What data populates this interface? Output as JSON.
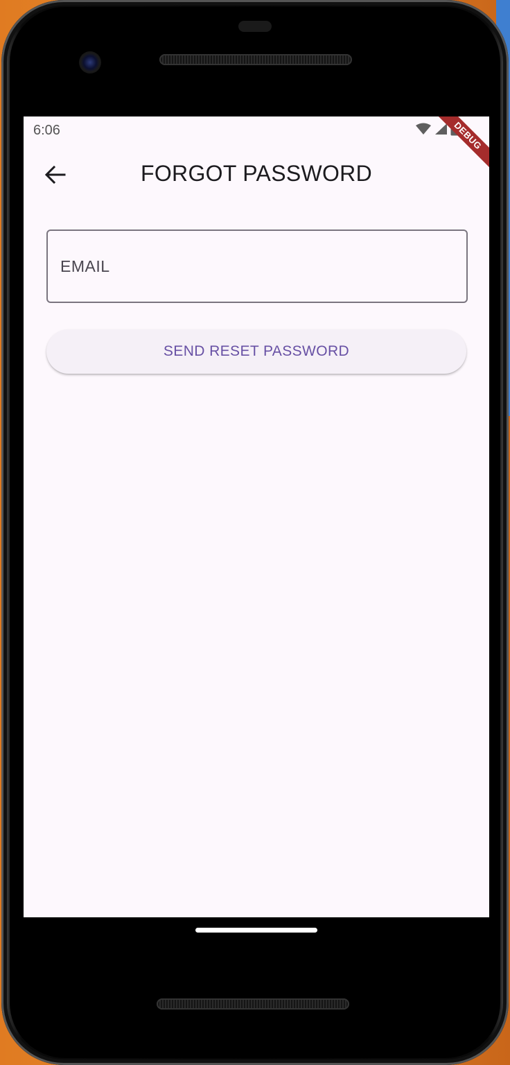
{
  "status_bar": {
    "time": "6:06",
    "icons": [
      "wifi-icon",
      "signal-icon",
      "battery-icon"
    ],
    "debug_label": "DEBUG"
  },
  "app_bar": {
    "back_icon": "arrow-back-icon",
    "title": "FORGOT PASSWORD"
  },
  "form": {
    "email_placeholder": "EMAIL",
    "email_value": "",
    "submit_label": "SEND RESET PASSWORD"
  },
  "colors": {
    "screen_background": "#fdf8fd",
    "accent": "#6750a4",
    "button_background": "#f5f0f7",
    "field_border": "#7a757f",
    "debug_banner": "#a52c2c"
  }
}
